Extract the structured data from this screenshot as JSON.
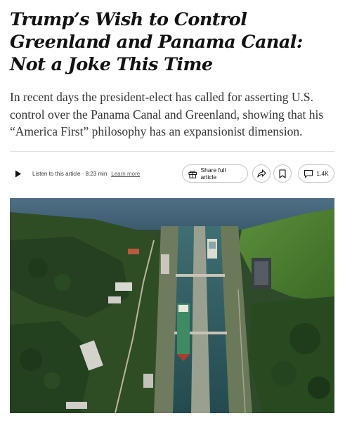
{
  "article": {
    "headline": "Trump’s Wish to Control Greenland and Panama Canal: Not a Joke This Time",
    "summary": "In recent days the president-elect has called for asserting U.S. control over the Panama Canal and Greenland, showing that his “America First” philosophy has an expansionist dimension."
  },
  "toolbar": {
    "listen_text": "Listen to this article · 8:23 min",
    "learn_more": "Learn more",
    "share_full_label": "Share full article",
    "comment_count": "1.4K",
    "icons": [
      "play-icon",
      "gift-icon",
      "share-arrow-icon",
      "bookmark-icon",
      "comment-icon"
    ]
  },
  "photo": {
    "subject": "aerial-canal-locks-with-ship"
  },
  "colors": {
    "text": "#121212",
    "summary_text": "#363636",
    "border": "#c7c7c7"
  }
}
